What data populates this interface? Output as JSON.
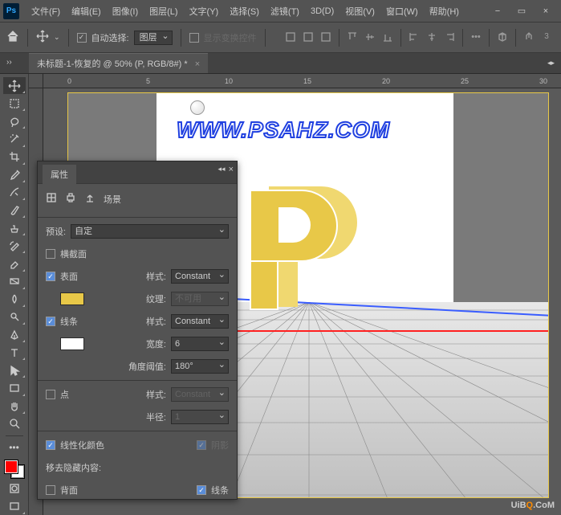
{
  "menu": {
    "items": [
      "文件(F)",
      "编辑(E)",
      "图像(I)",
      "图层(L)",
      "文字(Y)",
      "选择(S)",
      "滤镜(T)",
      "3D(D)",
      "视图(V)",
      "窗口(W)",
      "帮助(H)"
    ]
  },
  "window": {
    "minimize": "−",
    "restore": "▭",
    "close": "×"
  },
  "options": {
    "auto_select_label": "自动选择:",
    "target_dropdown": "图层",
    "show_transform": "显示变换控件"
  },
  "doc": {
    "tab_title": "未标题-1-恢复的 @ 50% (P, RGB/8#) *"
  },
  "ruler_ticks": [
    "0",
    "5",
    "10",
    "15",
    "20",
    "25",
    "30"
  ],
  "watermark": "WWW.PSAHZ.COM",
  "bottom_watermark": {
    "pre": "UiB",
    "mid": "Q",
    "post": ".CoM"
  },
  "panel": {
    "title": "属性",
    "scene_label": "场景",
    "preset_label": "预设:",
    "preset_value": "自定",
    "cross_section": "横截面",
    "surface": "表面",
    "surface_color": "#e8c848",
    "style_label": "样式:",
    "style_value": "Constant",
    "texture_label": "纹理:",
    "texture_value": "不可用",
    "lines": "线条",
    "lines_color": "#ffffff",
    "lines_style": "Constant",
    "width_label": "宽度:",
    "width_value": "6",
    "angle_label": "角度阈值:",
    "angle_value": "180°",
    "points": "点",
    "points_style": "Constant",
    "radius_label": "半径:",
    "radius_value": "1",
    "linearize": "线性化颜色",
    "shadow": "阴影",
    "remove_hidden": "移去隐藏内容:",
    "backface": "背面",
    "lines2": "线条"
  }
}
